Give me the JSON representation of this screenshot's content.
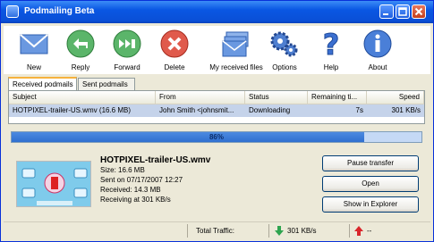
{
  "window": {
    "title": "Podmailing Beta",
    "min_icon": "minimize-icon",
    "max_icon": "maximize-icon",
    "close_icon": "close-icon"
  },
  "toolbar": [
    {
      "key": "new",
      "label": "New",
      "icon": "envelope-icon"
    },
    {
      "key": "reply",
      "label": "Reply",
      "icon": "reply-arrow-icon"
    },
    {
      "key": "forward",
      "label": "Forward",
      "icon": "forward-arrow-icon"
    },
    {
      "key": "delete",
      "label": "Delete",
      "icon": "delete-x-icon"
    },
    {
      "key": "received",
      "label": "My received files",
      "icon": "envelopes-stack-icon"
    },
    {
      "key": "options",
      "label": "Options",
      "icon": "gears-icon"
    },
    {
      "key": "help",
      "label": "Help",
      "icon": "question-mark-icon"
    },
    {
      "key": "about",
      "label": "About",
      "icon": "info-icon"
    }
  ],
  "tabs": [
    "Received podmails",
    "Sent podmails"
  ],
  "list": {
    "columns": [
      "Subject",
      "From",
      "Status",
      "Remaining ti...",
      "Speed"
    ],
    "rows": [
      [
        "HOTPIXEL-trailer-US.wmv (16.6 MB)",
        "John Smith <johnsmit...",
        "Downloading",
        "7s",
        "301 KB/s"
      ]
    ]
  },
  "progress": {
    "value": 86,
    "label": "86%"
  },
  "details": {
    "file_name": "HOTPIXEL-trailer-US.wmv",
    "size": "Size: 16.6 MB",
    "sent": "Sent on 07/17/2007 12:27",
    "received": "Received: 14.3 MB",
    "receiving": "Receiving at 301 KB/s"
  },
  "actions": {
    "pause": "Pause transfer",
    "open": "Open",
    "explorer": "Show in Explorer"
  },
  "statusbar": {
    "label": "Total Traffic:",
    "down": "301 KB/s",
    "up": "--",
    "down_icon": "download-arrow-icon",
    "up_icon": "upload-arrow-icon"
  },
  "colors": {
    "titlebar": "#0a57e3",
    "selection": "#c5d3ea",
    "progress": "#2f6fd0",
    "accent_tab": "#f6b23d"
  }
}
